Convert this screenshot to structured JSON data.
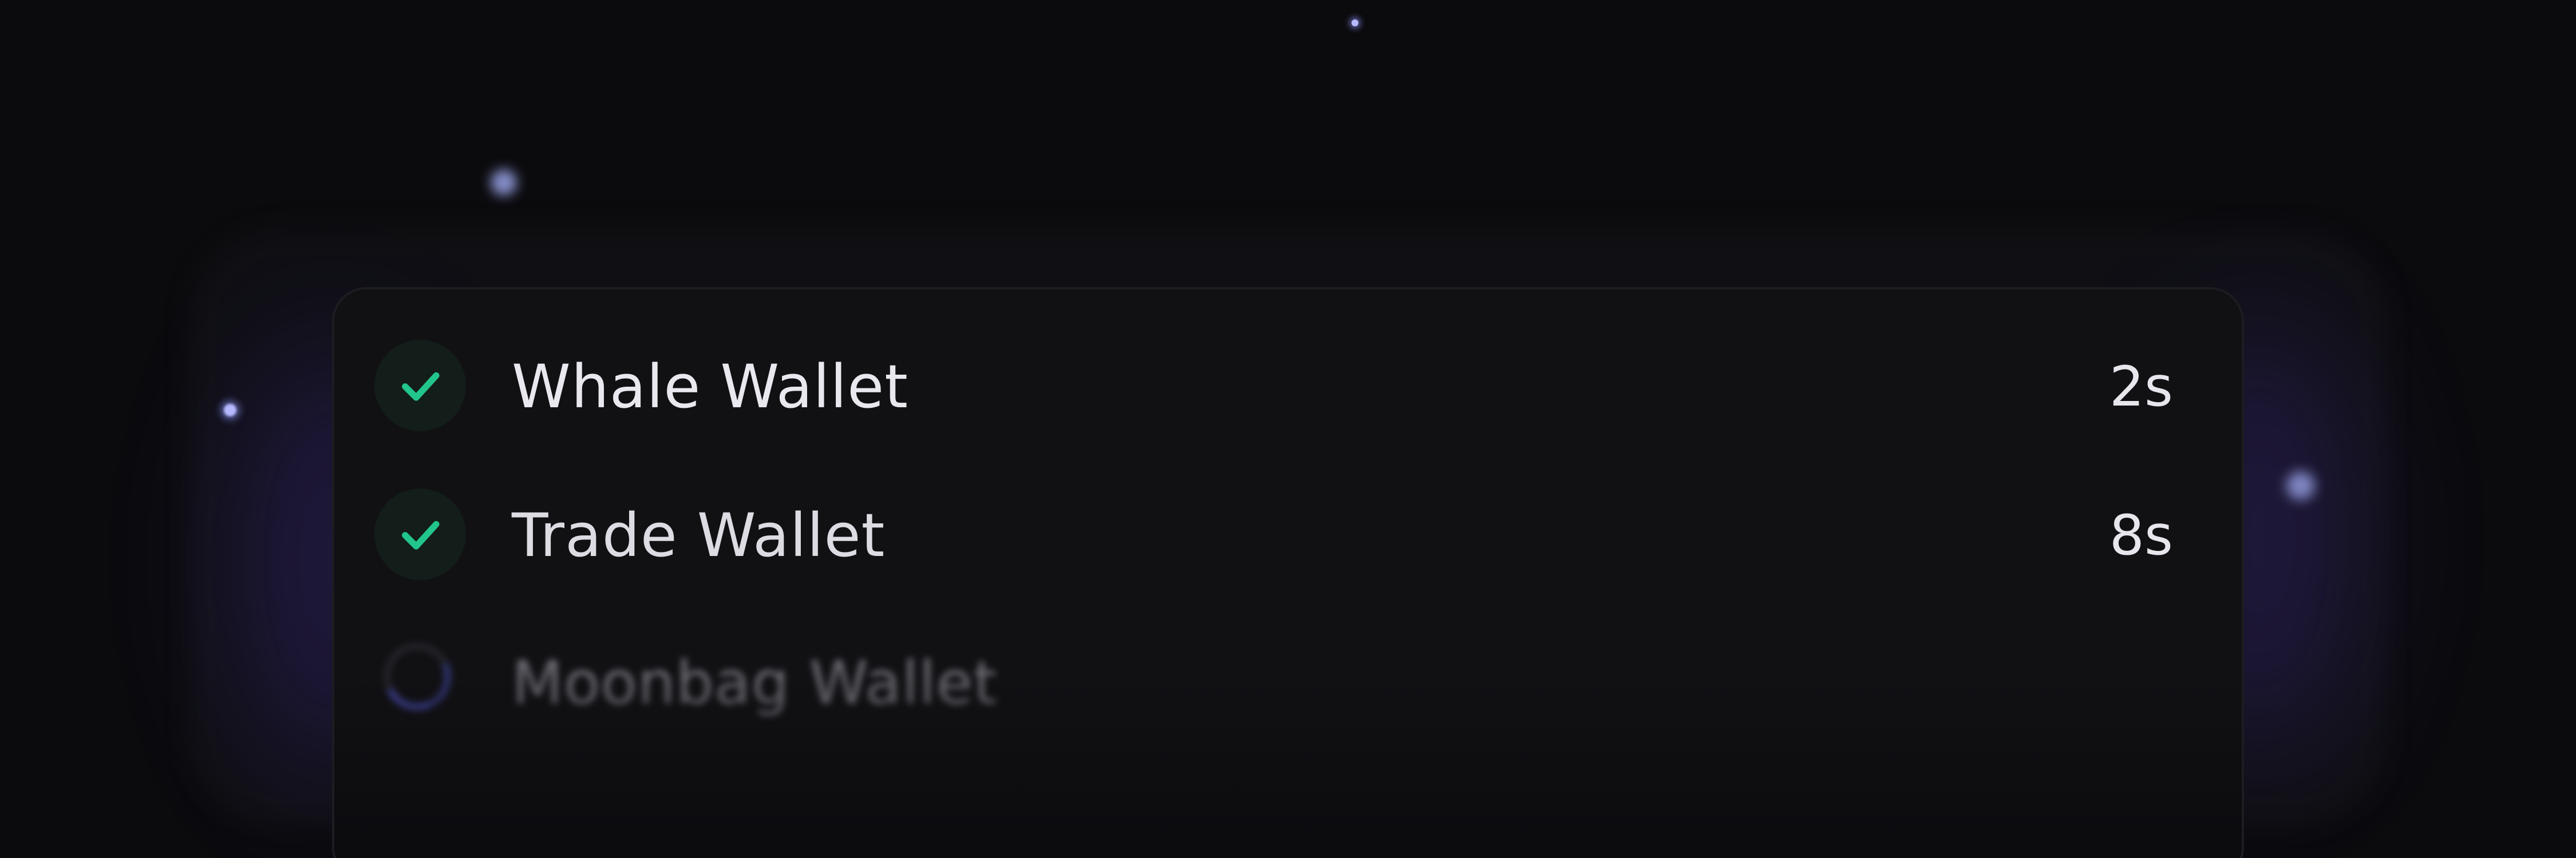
{
  "wallets": [
    {
      "name": "Whale Wallet",
      "time": "2s",
      "status": "done",
      "status_icon": "check-icon"
    },
    {
      "name": "Trade Wallet",
      "time": "8s",
      "status": "done",
      "status_icon": "check-icon"
    },
    {
      "name": "Moonbag Wallet",
      "time": "",
      "status": "loading",
      "status_icon": "spinner-icon"
    }
  ],
  "colors": {
    "background": "#0b0b0e",
    "card": "#111114",
    "check": "#22c58b",
    "spinner_accent": "#4c4fb8",
    "glow": "#5a3cd2"
  }
}
